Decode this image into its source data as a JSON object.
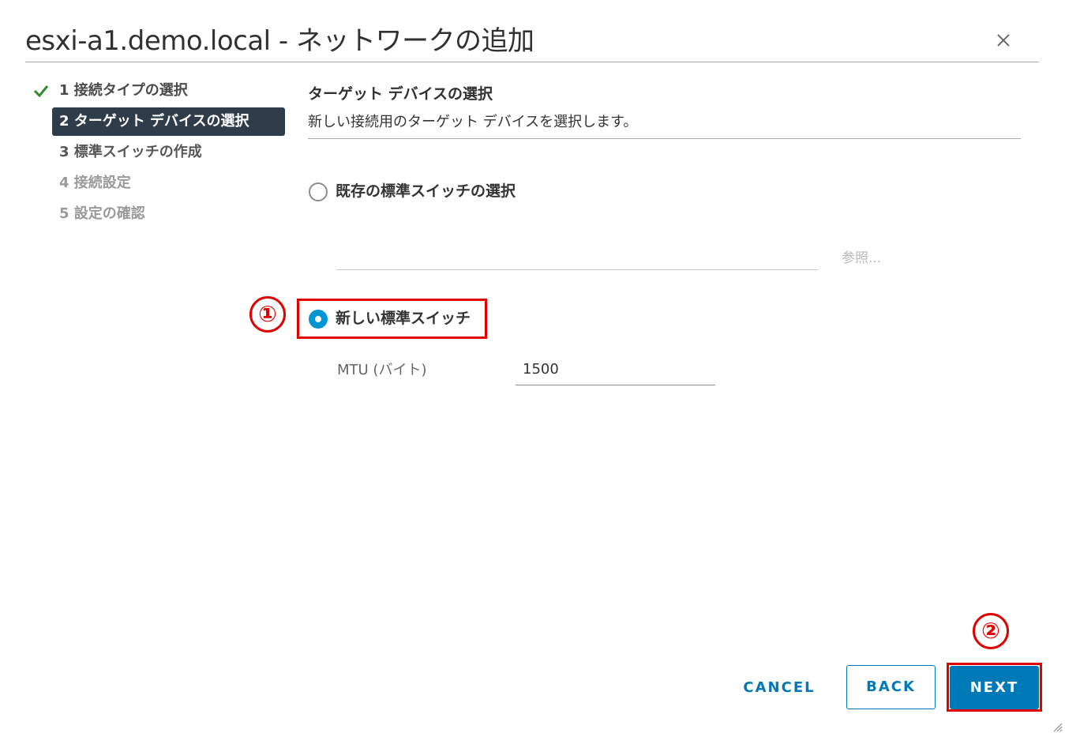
{
  "dialog": {
    "title": "esxi-a1.demo.local - ネットワークの追加",
    "close_icon": "close-icon"
  },
  "steps": [
    {
      "label": "1 接続タイプの選択",
      "state": "completed"
    },
    {
      "label": "2 ターゲット デバイスの選択",
      "state": "active"
    },
    {
      "label": "3 標準スイッチの作成",
      "state": "pending"
    },
    {
      "label": "4 接続設定",
      "state": "disabled"
    },
    {
      "label": "5 設定の確認",
      "state": "disabled"
    }
  ],
  "content": {
    "title": "ターゲット デバイスの選択",
    "description": "新しい接続用のターゲット デバイスを選択します。"
  },
  "options": {
    "existing_switch": {
      "label": "既存の標準スイッチの選択",
      "selected": false
    },
    "browse_label": "参照...",
    "new_switch": {
      "label": "新しい標準スイッチ",
      "selected": true
    },
    "mtu_label": "MTU (バイト)",
    "mtu_value": "1500"
  },
  "annotations": {
    "marker1": "①",
    "marker2": "②"
  },
  "buttons": {
    "cancel": "CANCEL",
    "back": "BACK",
    "next": "NEXT"
  },
  "colors": {
    "accent": "#0079b8",
    "radio_selected": "#0095d3",
    "active_step_bg": "#2f3d4a",
    "check_green": "#2e8b2e",
    "annotation_red": "#e00000"
  }
}
